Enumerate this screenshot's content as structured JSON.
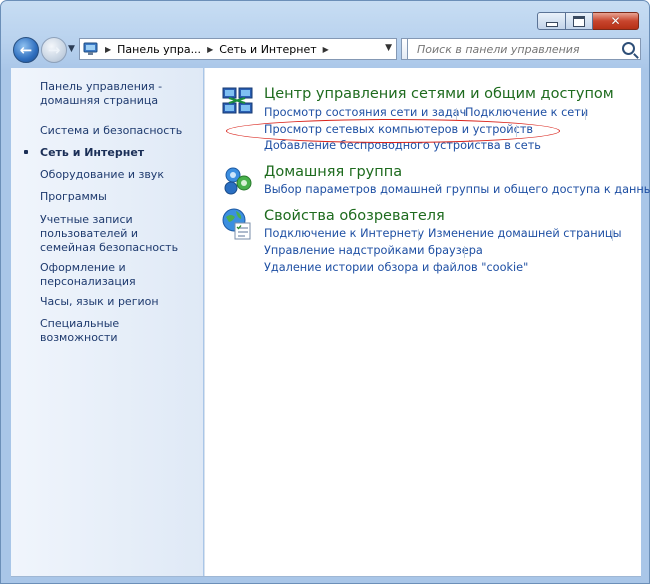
{
  "window": {
    "caption": {
      "minimize": "",
      "maximize": "",
      "close": "✕"
    }
  },
  "navbar": {
    "breadcrumbs": [
      "Панель упра...",
      "Сеть и Интернет"
    ],
    "search_placeholder": "Поиск в панели управления"
  },
  "sidebar": {
    "items": [
      {
        "label": "Панель управления - домашняя страница"
      },
      {
        "label": "Система и безопасность"
      },
      {
        "label": "Сеть и Интернет",
        "active": true
      },
      {
        "label": "Оборудование и звук"
      },
      {
        "label": "Программы"
      },
      {
        "label": "Учетные записи пользователей и семейная безопасность"
      },
      {
        "label": "Оформление и персонализация"
      },
      {
        "label": "Часы, язык и регион"
      },
      {
        "label": "Специальные возможности"
      }
    ]
  },
  "categories": [
    {
      "title": "Центр управления сетями и общим доступом",
      "icon": "network-center-icon",
      "links": [
        "Просмотр состояния сети и задач",
        "Подключение к сети",
        "Просмотр сетевых компьютеров и устройств",
        "Добавление беспроводного устройства в сеть"
      ]
    },
    {
      "title": "Домашняя группа",
      "icon": "homegroup-icon",
      "links": [
        "Выбор параметров домашней группы и общего доступа к данным"
      ]
    },
    {
      "title": "Свойства обозревателя",
      "icon": "internet-options-icon",
      "links": [
        "Подключение к Интернету",
        "Изменение домашней страницы",
        "Управление надстройками браузера",
        "Удаление истории обзора и файлов \"cookie\""
      ]
    }
  ],
  "colors": {
    "link": "#1e4fa3",
    "title": "#1e6b1e",
    "annotation": "#d9241c"
  }
}
